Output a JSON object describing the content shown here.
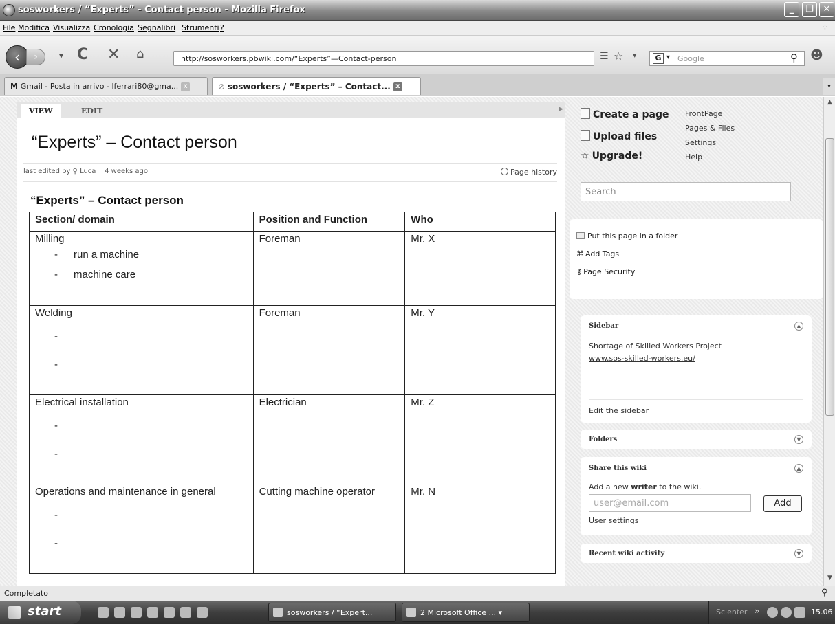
{
  "window": {
    "title": "sosworkers / “Experts” - Contact person - Mozilla Firefox"
  },
  "menu": [
    "File",
    "Modifica",
    "Visualizza",
    "Cronologia",
    "Segnalibri",
    "Strumenti",
    "?"
  ],
  "navbar": {
    "url": "http://sosworkers.pbwiki.com/“Experts”—Contact-person",
    "search_placeholder": "Google",
    "search_engine_icon": "G"
  },
  "tabs": [
    {
      "label": "Gmail - Posta in arrivo - lferrari80@gma...",
      "active": false
    },
    {
      "label": "sosworkers / “Experts” – Contact...",
      "active": true
    }
  ],
  "page": {
    "view_tab": "VIEW",
    "edit_tab": "EDIT",
    "title": "“Experts” – Contact person",
    "meta_prefix": "last edited by",
    "meta_user": "Luca",
    "meta_time": "4 weeks ago",
    "page_history": "Page history",
    "subtitle": "“Experts” – Contact person",
    "table": {
      "headers": [
        "Section/ domain",
        "Position and Function",
        "Who"
      ],
      "rows": [
        {
          "section": "Milling",
          "items": [
            "run a machine",
            "machine care"
          ],
          "position": "Foreman",
          "who": "Mr. X"
        },
        {
          "section": "Welding",
          "items": [
            "",
            ""
          ],
          "position": "Foreman",
          "who": "Mr. Y"
        },
        {
          "section": "Electrical installation",
          "items": [
            "",
            ""
          ],
          "position": "Electrician",
          "who": "Mr. Z"
        },
        {
          "section": "Operations and maintenance in general",
          "items": [
            "",
            ""
          ],
          "position": "Cutting machine operator",
          "who": "Mr. N"
        }
      ]
    }
  },
  "sidebar_panel": {
    "actions": {
      "create": "Create a page",
      "upload": "Upload files",
      "upgrade": "Upgrade!"
    },
    "links": {
      "frontpage": "FrontPage",
      "pages_files": "Pages & Files",
      "settings": "Settings",
      "help": "Help"
    },
    "search_placeholder": "Search",
    "page_tools": {
      "folder": "Put this page in a folder",
      "tags": "Add Tags",
      "security": "Page Security"
    },
    "sidebar_widget": {
      "title": "Sidebar",
      "line1": "Shortage of Skilled Workers Project",
      "link": "www.sos-skilled-workers.eu/",
      "edit": "Edit the sidebar"
    },
    "folders_title": "Folders",
    "share": {
      "title": "Share this wiki",
      "text_prefix": "Add a new",
      "text_bold": "writer",
      "text_suffix": "to the wiki.",
      "email_placeholder": "user@email.com",
      "add_button": "Add",
      "user_settings": "User settings"
    },
    "recent_title": "Recent wiki activity"
  },
  "status": "Completato",
  "taskbar": {
    "start": "start",
    "tasks": [
      {
        "label": "sosworkers / “Expert..."
      },
      {
        "label": "2 Microsoft Office ..."
      }
    ],
    "tray_label": "Scienter",
    "clock": "15.06"
  }
}
